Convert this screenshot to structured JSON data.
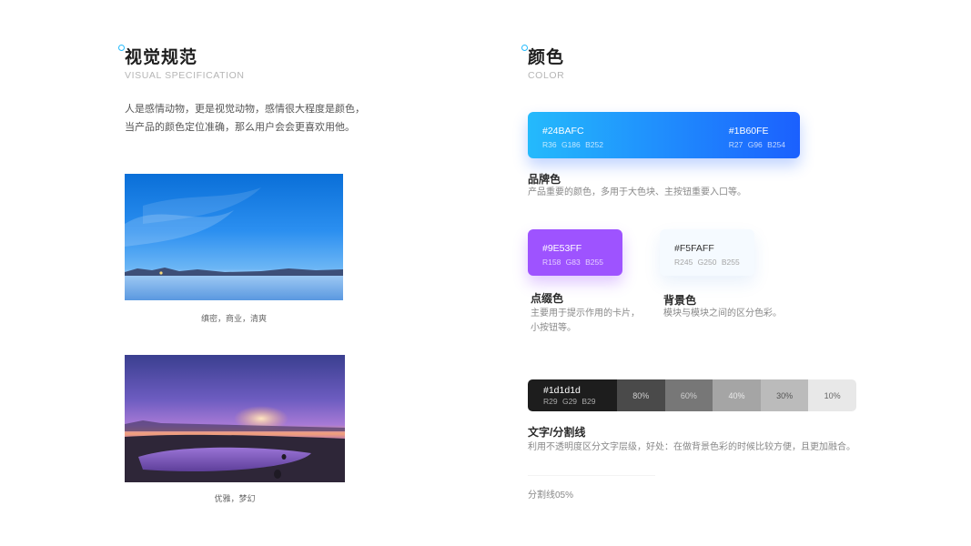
{
  "left": {
    "title": "视觉规范",
    "subtitle": "VISUAL SPECIFICATION",
    "intro": [
      "人是感情动物，更是视觉动物，感情很大程度是颜色，",
      "当产品的颜色定位准确，那么用户会会更喜欢用他。"
    ],
    "photos": [
      {
        "caption": "缜密，商业，清爽"
      },
      {
        "caption": "优雅，梦幻"
      }
    ]
  },
  "right": {
    "title": "颜色",
    "subtitle": "COLOR",
    "brand": {
      "start": {
        "hex": "#24BAFC",
        "rgb": "R36  G186  B252"
      },
      "end": {
        "hex": "#1B60FE",
        "rgb": "R27  G96  B254"
      },
      "title": "品牌色",
      "desc": "产品重要的颜色，多用于大色块、主按钮重要入口等。"
    },
    "accent": {
      "hex": "#9E53FF",
      "rgb": "R158  G83  B255",
      "title": "点缀色",
      "desc": [
        "主要用于提示作用的卡片，",
        "小按钮等。"
      ]
    },
    "background": {
      "hex": "#F5FAFF",
      "rgb": "R245  G250  B255",
      "title": "背景色",
      "desc": "模块与模块之间的区分色彩。"
    },
    "text": {
      "hex": "#1d1d1d",
      "rgb": "R29  G29  B29",
      "steps": [
        "80%",
        "60%",
        "40%",
        "30%",
        "10%"
      ],
      "title": "文字/分割线",
      "desc": "利用不透明度区分文字层级，好处：在做背景色彩的时候比较方便，且更加融合。"
    },
    "divider": {
      "label": "分割线05%"
    }
  },
  "colors": {
    "brand_start": "#24BAFC",
    "brand_end": "#1B60FE",
    "accent": "#9E53FF",
    "background": "#F5FAFF",
    "text": "#1D1D1D"
  },
  "icons": {
    "heading_marker": "circle-dot-icon"
  }
}
